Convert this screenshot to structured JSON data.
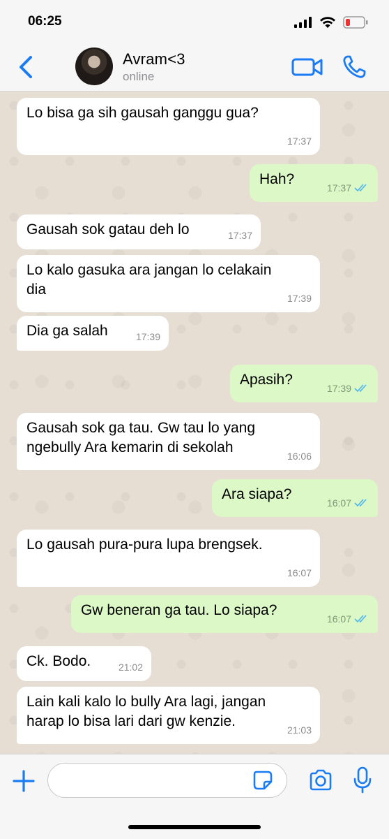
{
  "status_bar": {
    "time": "06:25"
  },
  "header": {
    "contact_name": "Avram<3",
    "contact_status": "online"
  },
  "colors": {
    "accent": "#1a7cf5",
    "incoming_bubble": "#ffffff",
    "outgoing_bubble": "#dcf8c6",
    "chat_background": "#e6ded3",
    "read_ticks": "#4fb6ec"
  },
  "icons": [
    "back-chevron-icon",
    "video-call-icon",
    "phone-icon",
    "plus-icon",
    "sticker-icon",
    "camera-icon",
    "microphone-icon"
  ],
  "messages": [
    {
      "direction": "incoming",
      "text": "Lo bisa ga sih gausah ganggu gua?",
      "time": "17:37"
    },
    {
      "direction": "outgoing",
      "text": "Hah?",
      "time": "17:37",
      "read": true
    },
    {
      "direction": "incoming",
      "text": "Gausah sok gatau deh lo",
      "time": "17:37"
    },
    {
      "direction": "incoming",
      "text": "Lo kalo gasuka ara jangan lo celakain dia",
      "time": "17:39"
    },
    {
      "direction": "incoming",
      "text": "Dia ga salah",
      "time": "17:39"
    },
    {
      "direction": "outgoing",
      "text": "Apasih?",
      "time": "17:39",
      "read": true
    },
    {
      "direction": "incoming",
      "text": "Gausah sok ga tau. Gw tau lo yang ngebully Ara kemarin di sekolah",
      "time": "16:06"
    },
    {
      "direction": "outgoing",
      "text": "Ara siapa?",
      "time": "16:07",
      "read": true
    },
    {
      "direction": "incoming",
      "text": "Lo gausah pura-pura lupa brengsek.",
      "time": "16:07"
    },
    {
      "direction": "outgoing",
      "text": "Gw beneran ga tau. Lo siapa?",
      "time": "16:07",
      "read": true
    },
    {
      "direction": "incoming",
      "text": "Ck. Bodo.",
      "time": "21:02"
    },
    {
      "direction": "incoming",
      "text": "Lain kali kalo lo bully Ara lagi, jangan harap lo bisa lari dari gw kenzie.",
      "time": "21:03"
    }
  ],
  "composer": {
    "value": "",
    "placeholder": ""
  }
}
